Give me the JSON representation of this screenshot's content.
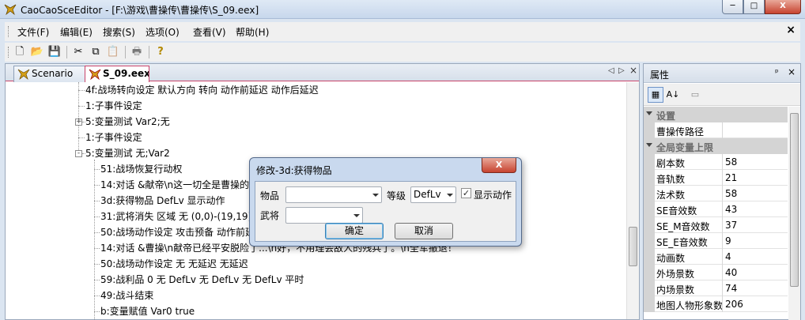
{
  "window": {
    "title": "CaoCaoSceEditor - [F:\\游戏\\曹操传\\曹操传\\S_09.eex]",
    "min": "─",
    "max": "□",
    "close": "X"
  },
  "menu": {
    "items": [
      "文件(F)",
      "编辑(E)",
      "搜索(S)",
      "选项(O)",
      "查看(V)",
      "帮助(H)"
    ],
    "mdi_close": "×"
  },
  "toolbar": {
    "buttons": [
      {
        "icon": "new-file-icon",
        "glyph": "🗋"
      },
      {
        "icon": "open-folder-icon",
        "glyph": "📂"
      },
      {
        "icon": "save-icon",
        "glyph": "💾"
      },
      {
        "icon": "cut-icon",
        "glyph": "✂"
      },
      {
        "icon": "copy-icon",
        "glyph": "⧉"
      },
      {
        "icon": "paste-icon",
        "glyph": "📋"
      },
      {
        "icon": "print-icon",
        "glyph": "🖶"
      },
      {
        "icon": "help-icon",
        "glyph": "?"
      }
    ]
  },
  "tabs": [
    {
      "label": "Scenario",
      "active": false
    },
    {
      "label": "S_09.eex",
      "active": true
    }
  ],
  "tab_nav": {
    "left": "◁",
    "right": "▷",
    "close": "×"
  },
  "tree": [
    {
      "text": "4f:战场转向设定   默认方向 转向 动作前延迟 动作后延迟",
      "level": 0,
      "expander": ""
    },
    {
      "text": "1:子事件设定",
      "level": 0,
      "expander": ""
    },
    {
      "text": "5:变量测试 Var2;无",
      "level": 0,
      "expander": "+"
    },
    {
      "text": "1:子事件设定",
      "level": 0,
      "expander": ""
    },
    {
      "text": "5:变量测试 无;Var2",
      "level": 0,
      "expander": "-"
    },
    {
      "text": "51:战场恢复行动权",
      "level": 1,
      "expander": ""
    },
    {
      "text": "14:对话 &献帝\\n这一切全是曹操的",
      "level": 1,
      "expander": ""
    },
    {
      "text": "3d:获得物品  DefLv 显示动作",
      "level": 1,
      "expander": ""
    },
    {
      "text": "31:武将消失 区域 无 (0,0)-(19,19) 无",
      "level": 1,
      "expander": ""
    },
    {
      "text": "50:战场动作设定  攻击预备 动作前延迟",
      "level": 1,
      "expander": ""
    },
    {
      "text": "14:对话 &曹操\\n献帝已经平安脱险了...\\n好，不用理会敌人的残兵了。\\n全军撤退！",
      "level": 1,
      "expander": ""
    },
    {
      "text": "50:战场动作设定  无 无延迟 无延迟",
      "level": 1,
      "expander": ""
    },
    {
      "text": "59:战利品 0 无 DefLv 无 DefLv 无 DefLv 平时",
      "level": 1,
      "expander": ""
    },
    {
      "text": "49:战斗结束",
      "level": 1,
      "expander": ""
    },
    {
      "text": "b:变量赋值 Var0 true",
      "level": 1,
      "expander": ""
    }
  ],
  "properties": {
    "title": "属性",
    "pin": "ᵖ",
    "close": "×",
    "toolbar": [
      {
        "icon": "categorized-icon",
        "glyph": "▦"
      },
      {
        "icon": "alphabetical-sort-icon",
        "glyph": "A↓"
      },
      {
        "icon": "property-pages-icon",
        "glyph": "▭"
      }
    ],
    "rows": [
      {
        "kind": "category",
        "name": "设置",
        "value": ""
      },
      {
        "kind": "prop",
        "name": "曹操传路径",
        "value": ""
      },
      {
        "kind": "category",
        "name": "全局变量上限",
        "value": ""
      },
      {
        "kind": "prop",
        "name": "剧本数",
        "value": "58"
      },
      {
        "kind": "prop",
        "name": "音轨数",
        "value": "21"
      },
      {
        "kind": "prop",
        "name": "法术数",
        "value": "58"
      },
      {
        "kind": "prop",
        "name": "SE音效数",
        "value": "43"
      },
      {
        "kind": "prop",
        "name": "SE_M音效数",
        "value": "37"
      },
      {
        "kind": "prop",
        "name": "SE_E音效数",
        "value": "9"
      },
      {
        "kind": "prop",
        "name": "动画数",
        "value": "4"
      },
      {
        "kind": "prop",
        "name": "外场景数",
        "value": "40"
      },
      {
        "kind": "prop",
        "name": "内场景数",
        "value": "74"
      },
      {
        "kind": "prop",
        "name": "地图人物形象数",
        "value": "206"
      }
    ]
  },
  "dialog": {
    "title": "修改-3d:获得物品",
    "close": "X",
    "item_label": "物品",
    "item_value": "",
    "level_label": "等级",
    "level_value": "DefLv",
    "show_anim_label": "显示动作",
    "show_anim_checked": "✓",
    "general_label": "武将",
    "general_value": "",
    "ok_label": "确定",
    "cancel_label": "取消"
  }
}
